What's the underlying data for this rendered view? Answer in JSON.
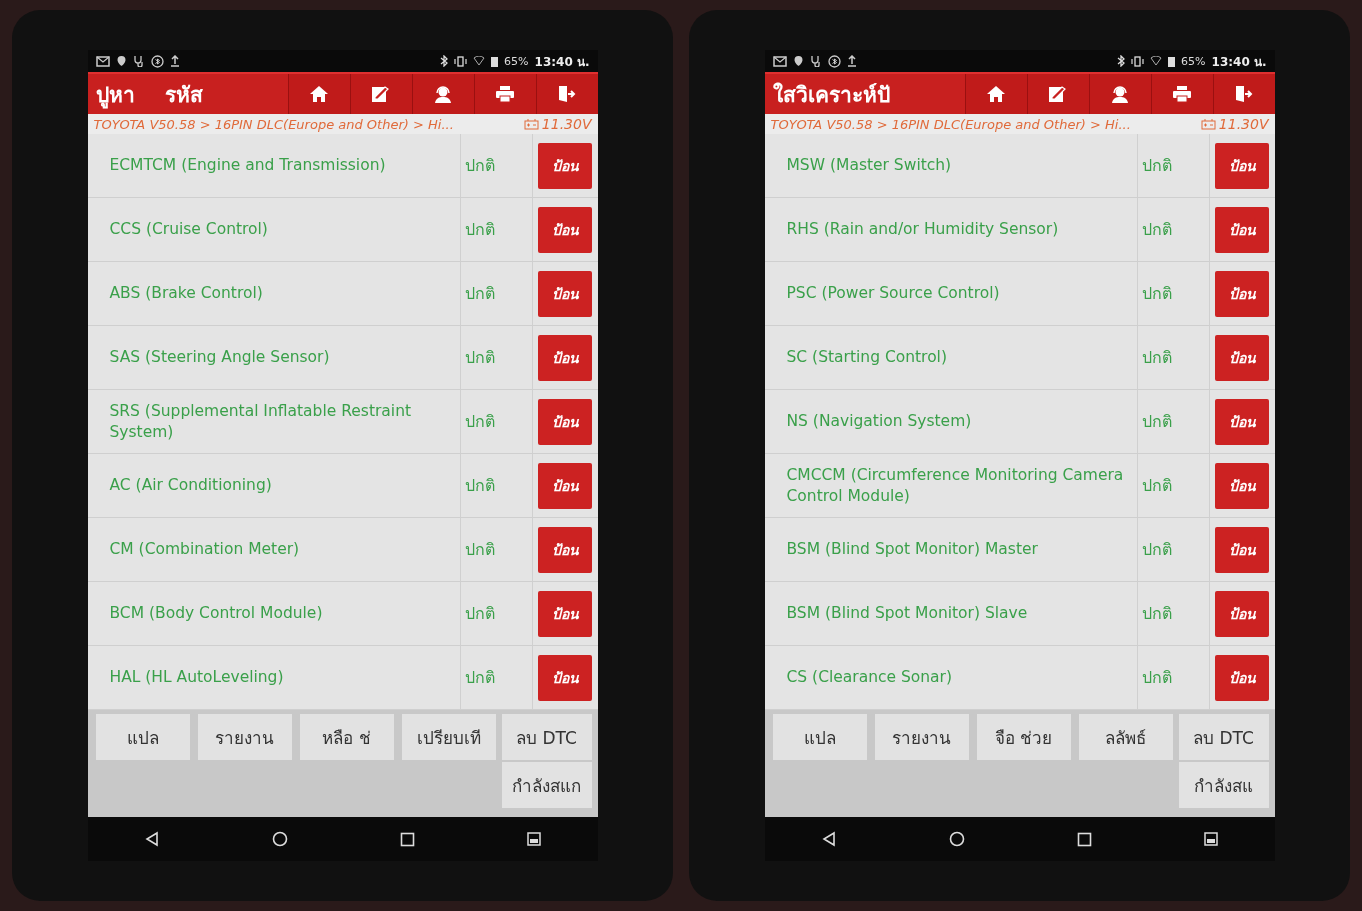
{
  "screens": [
    {
      "status_bar": {
        "battery": "65%",
        "time": "13:40 น."
      },
      "header": {
        "titles": [
          "ปูหา",
          "รหัส"
        ]
      },
      "breadcrumb": "TOYOTA V50.58 > 16PIN DLC(Europe and Other) > Hi...",
      "voltage": "11.30V",
      "rows": [
        {
          "name": "ECMTCM (Engine and Transmission)",
          "status": "ปกติ",
          "action": "ป้อน"
        },
        {
          "name": "CCS (Cruise Control)",
          "status": "ปกติ",
          "action": "ป้อน"
        },
        {
          "name": "ABS (Brake Control)",
          "status": "ปกติ",
          "action": "ป้อน"
        },
        {
          "name": "SAS (Steering Angle Sensor)",
          "status": "ปกติ",
          "action": "ป้อน"
        },
        {
          "name": "SRS (Supplemental Inflatable Restraint System)",
          "status": "ปกติ",
          "action": "ป้อน"
        },
        {
          "name": "AC (Air Conditioning)",
          "status": "ปกติ",
          "action": "ป้อน"
        },
        {
          "name": "CM (Combination Meter)",
          "status": "ปกติ",
          "action": "ป้อน"
        },
        {
          "name": "BCM (Body Control Module)",
          "status": "ปกติ",
          "action": "ป้อน"
        },
        {
          "name": "HAL (HL AutoLeveling)",
          "status": "ปกติ",
          "action": "ป้อน"
        }
      ],
      "buttons": [
        "แปล",
        "รายงาน",
        "หลือ ช่",
        "เปรียบเที"
      ],
      "side_buttons": [
        "ลบ DTC",
        "กำลังสแก"
      ]
    },
    {
      "status_bar": {
        "battery": "65%",
        "time": "13:40 น."
      },
      "header": {
        "titles": [
          "ใสวิเคราะห์ปั"
        ]
      },
      "breadcrumb": "TOYOTA V50.58 > 16PIN DLC(Europe and Other) > Hi...",
      "voltage": "11.30V",
      "rows": [
        {
          "name": "MSW (Master Switch)",
          "status": "ปกติ",
          "action": "ป้อน"
        },
        {
          "name": "RHS (Rain and/or Humidity Sensor)",
          "status": "ปกติ",
          "action": "ป้อน"
        },
        {
          "name": "PSC (Power Source Control)",
          "status": "ปกติ",
          "action": "ป้อน"
        },
        {
          "name": "SC (Starting Control)",
          "status": "ปกติ",
          "action": "ป้อน"
        },
        {
          "name": "NS (Navigation System)",
          "status": "ปกติ",
          "action": "ป้อน"
        },
        {
          "name": "CMCCM (Circumference Monitoring Camera Control Module)",
          "status": "ปกติ",
          "action": "ป้อน"
        },
        {
          "name": "BSM (Blind Spot Monitor) Master",
          "status": "ปกติ",
          "action": "ป้อน"
        },
        {
          "name": "BSM (Blind Spot Monitor) Slave",
          "status": "ปกติ",
          "action": "ป้อน"
        },
        {
          "name": "CS (Clearance Sonar)",
          "status": "ปกติ",
          "action": "ป้อน"
        }
      ],
      "buttons": [
        "แปล",
        "รายงาน",
        "จือ ช่วย",
        "ลลัพธ์"
      ],
      "side_buttons": [
        "ลบ DTC",
        "กำลังสแ"
      ]
    }
  ]
}
